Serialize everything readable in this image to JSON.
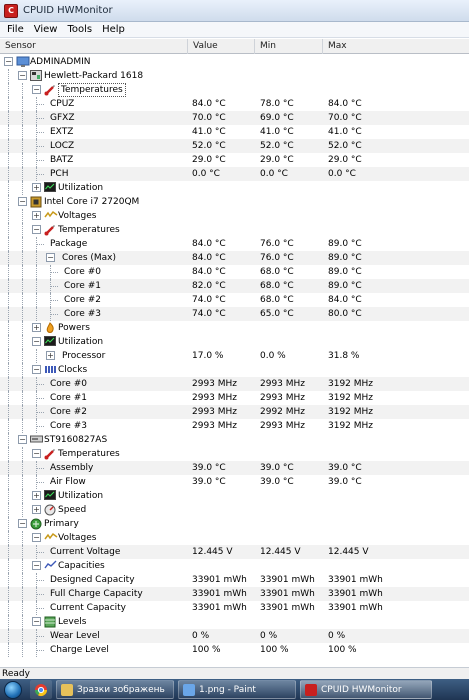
{
  "window": {
    "title": "CPUID HWMonitor",
    "icon_label": "C"
  },
  "menu": [
    "File",
    "View",
    "Tools",
    "Help"
  ],
  "columns": {
    "sensor": "Sensor",
    "value": "Value",
    "min": "Min",
    "max": "Max"
  },
  "rows": [
    {
      "label": "ADMINADMIN",
      "level": 0,
      "toggle": "-",
      "icon": "computer-icon"
    },
    {
      "label": "Hewlett-Packard 1618",
      "level": 1,
      "toggle": "-",
      "icon": "motherboard-icon"
    },
    {
      "label": "Temperatures",
      "level": 2,
      "toggle": "-",
      "icon": "thermometer-icon",
      "selected": true
    },
    {
      "label": "CPUZ",
      "level": 3,
      "value": "84.0 °C",
      "min": "78.0 °C",
      "max": "84.0 °C"
    },
    {
      "label": "GFXZ",
      "level": 3,
      "value": "70.0 °C",
      "min": "69.0 °C",
      "max": "70.0 °C"
    },
    {
      "label": "EXTZ",
      "level": 3,
      "value": "41.0 °C",
      "min": "41.0 °C",
      "max": "41.0 °C"
    },
    {
      "label": "LOCZ",
      "level": 3,
      "value": "52.0 °C",
      "min": "52.0 °C",
      "max": "52.0 °C"
    },
    {
      "label": "BATZ",
      "level": 3,
      "value": "29.0 °C",
      "min": "29.0 °C",
      "max": "29.0 °C"
    },
    {
      "label": "PCH",
      "level": 3,
      "value": "0.0 °C",
      "min": "0.0 °C",
      "max": "0.0 °C"
    },
    {
      "label": "Utilization",
      "level": 2,
      "toggle": "+",
      "icon": "utilization-icon"
    },
    {
      "label": "Intel Core i7 2720QM",
      "level": 1,
      "toggle": "-",
      "icon": "cpu-icon"
    },
    {
      "label": "Voltages",
      "level": 2,
      "toggle": "+",
      "icon": "voltage-icon"
    },
    {
      "label": "Temperatures",
      "level": 2,
      "toggle": "-",
      "icon": "thermometer-icon"
    },
    {
      "label": "Package",
      "level": 3,
      "value": "84.0 °C",
      "min": "76.0 °C",
      "max": "89.0 °C"
    },
    {
      "label": "Cores (Max)",
      "level": 3,
      "toggle": "-",
      "value": "84.0 °C",
      "min": "76.0 °C",
      "max": "89.0 °C"
    },
    {
      "label": "Core #0",
      "level": 4,
      "value": "84.0 °C",
      "min": "68.0 °C",
      "max": "89.0 °C"
    },
    {
      "label": "Core #1",
      "level": 4,
      "value": "82.0 °C",
      "min": "68.0 °C",
      "max": "89.0 °C"
    },
    {
      "label": "Core #2",
      "level": 4,
      "value": "74.0 °C",
      "min": "68.0 °C",
      "max": "84.0 °C"
    },
    {
      "label": "Core #3",
      "level": 4,
      "value": "74.0 °C",
      "min": "65.0 °C",
      "max": "80.0 °C"
    },
    {
      "label": "Powers",
      "level": 2,
      "toggle": "+",
      "icon": "power-icon"
    },
    {
      "label": "Utilization",
      "level": 2,
      "toggle": "-",
      "icon": "utilization-icon"
    },
    {
      "label": "Processor",
      "level": 3,
      "toggle": "+",
      "value": "17.0 %",
      "min": "0.0 %",
      "max": "31.8 %"
    },
    {
      "label": "Clocks",
      "level": 2,
      "toggle": "-",
      "icon": "clock-icon"
    },
    {
      "label": "Core #0",
      "level": 3,
      "value": "2993 MHz",
      "min": "2993 MHz",
      "max": "3192 MHz"
    },
    {
      "label": "Core #1",
      "level": 3,
      "value": "2993 MHz",
      "min": "2993 MHz",
      "max": "3192 MHz"
    },
    {
      "label": "Core #2",
      "level": 3,
      "value": "2993 MHz",
      "min": "2992 MHz",
      "max": "3192 MHz"
    },
    {
      "label": "Core #3",
      "level": 3,
      "value": "2993 MHz",
      "min": "2993 MHz",
      "max": "3192 MHz"
    },
    {
      "label": "ST9160827AS",
      "level": 1,
      "toggle": "-",
      "icon": "disk-icon"
    },
    {
      "label": "Temperatures",
      "level": 2,
      "toggle": "-",
      "icon": "thermometer-icon"
    },
    {
      "label": "Assembly",
      "level": 3,
      "value": "39.0 °C",
      "min": "39.0 °C",
      "max": "39.0 °C"
    },
    {
      "label": "Air Flow",
      "level": 3,
      "value": "39.0 °C",
      "min": "39.0 °C",
      "max": "39.0 °C"
    },
    {
      "label": "Utilization",
      "level": 2,
      "toggle": "+",
      "icon": "utilization-icon"
    },
    {
      "label": "Speed",
      "level": 2,
      "toggle": "+",
      "icon": "speed-icon"
    },
    {
      "label": "Primary",
      "level": 1,
      "toggle": "-",
      "icon": "battery-icon"
    },
    {
      "label": "Voltages",
      "level": 2,
      "toggle": "-",
      "icon": "voltage-icon"
    },
    {
      "label": "Current Voltage",
      "level": 3,
      "value": "12.445 V",
      "min": "12.445 V",
      "max": "12.445 V"
    },
    {
      "label": "Capacities",
      "level": 2,
      "toggle": "-",
      "icon": "capacity-icon"
    },
    {
      "label": "Designed Capacity",
      "level": 3,
      "value": "33901 mWh",
      "min": "33901 mWh",
      "max": "33901 mWh"
    },
    {
      "label": "Full Charge Capacity",
      "level": 3,
      "value": "33901 mWh",
      "min": "33901 mWh",
      "max": "33901 mWh"
    },
    {
      "label": "Current Capacity",
      "level": 3,
      "value": "33901 mWh",
      "min": "33901 mWh",
      "max": "33901 mWh"
    },
    {
      "label": "Levels",
      "level": 2,
      "toggle": "-",
      "icon": "levels-icon"
    },
    {
      "label": "Wear Level",
      "level": 3,
      "value": "0 %",
      "min": "0 %",
      "max": "0 %"
    },
    {
      "label": "Charge Level",
      "level": 3,
      "value": "100 %",
      "min": "100 %",
      "max": "100 %"
    }
  ],
  "status": "Ready",
  "taskbar": {
    "buttons": [
      {
        "label": "Зразки зображень",
        "icon": "folder-icon"
      },
      {
        "label": "1.png - Paint",
        "icon": "paint-icon"
      },
      {
        "label": "CPUID HWMonitor",
        "icon": "hwmonitor-icon",
        "active": true
      }
    ]
  },
  "colors": {
    "accent_red": "#c8201f",
    "selected_row": "#cfe3ff",
    "taskbar": "#27405f"
  }
}
